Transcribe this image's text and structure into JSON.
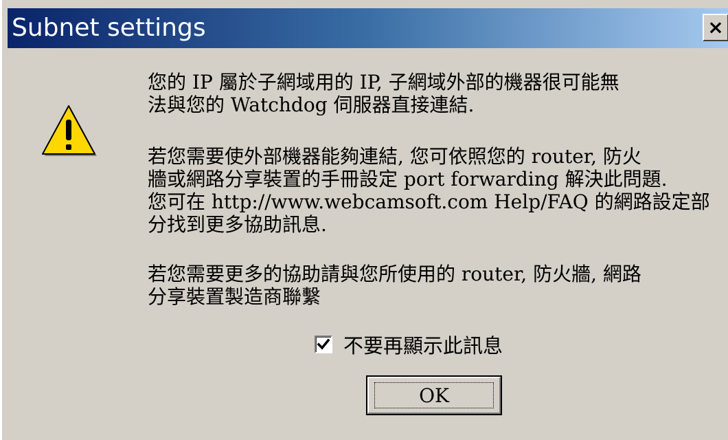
{
  "dialog": {
    "title": "Subnet settings",
    "close_label": "×",
    "icon": "warning-triangle-icon",
    "message1": [
      "您的 IP 屬於子網域用的 IP, 子網域外部的機器很可能無",
      "法與您的 Watchdog 伺服器直接連結."
    ],
    "message2": [
      "若您需要使外部機器能夠連結, 您可依照您的 router, 防火",
      "牆或網路分享裝置的手冊設定 port forwarding 解決此問題.",
      "您可在 http://www.webcamsoft.com Help/FAQ 的網路設定部",
      "分找到更多協助訊息."
    ],
    "message3": [
      "若您需要更多的協助請與您所使用的 router, 防火牆, 網路",
      "分享裝置製造商聯繫"
    ],
    "checkbox": {
      "label": "不要再顯示此訊息",
      "checked": true
    },
    "ok_label": "OK"
  },
  "colors": {
    "title_gradient_start": "#0a246a",
    "title_gradient_end": "#a6caf0",
    "dialog_background": "#d4d0c8",
    "warning_yellow": "#ffd700"
  }
}
